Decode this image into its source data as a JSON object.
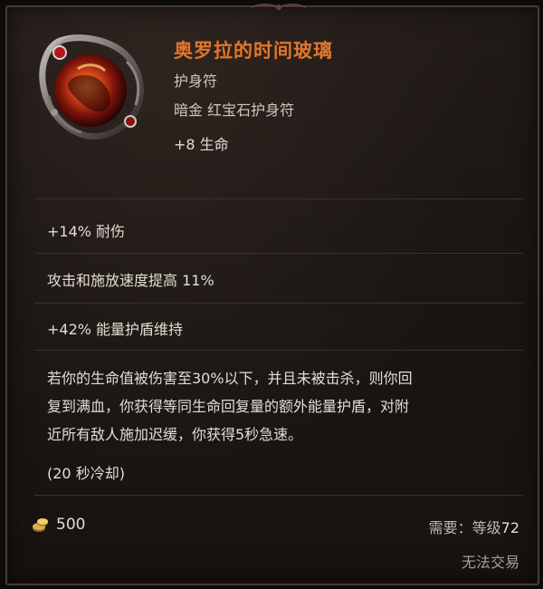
{
  "item": {
    "name": "奥罗拉的时间玻璃",
    "base_type": "护身符",
    "quality_type": "暗金 红宝石护身符",
    "implicit": "+8 生命",
    "icon": "ruby-amulet-icon"
  },
  "mods": [
    "+14% 耐伤",
    "攻击和施放速度提高 11%",
    "+42% 能量护盾维持"
  ],
  "description_lines": [
    "若你的生命值被伤害至30%以下，并且未被击杀，则你回",
    "复到满血，你获得等同生命回复量的额外能量护盾，对附",
    "近所有敌人施加迟缓，你获得5秒急速。"
  ],
  "cooldown": "(20 秒冷却)",
  "footer": {
    "price_icon": "gold-coin-icon",
    "price": "500",
    "requirement_label": "需要：等级",
    "requirement_value": "72",
    "tradable": "无法交易"
  },
  "colors": {
    "item_name": "#e2752a",
    "text": "#e2dcd3",
    "background": "#1b1613",
    "border": "#4a3a30"
  }
}
